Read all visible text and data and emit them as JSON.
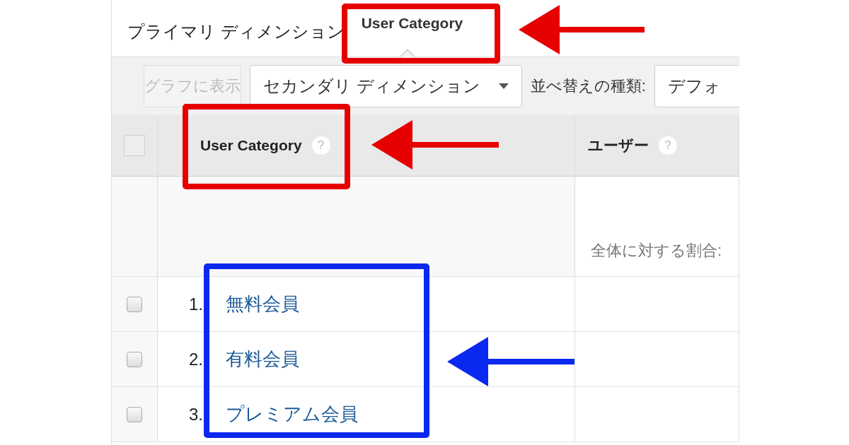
{
  "primary_dimension": {
    "label": "プライマリ ディメンション",
    "tabs": [
      {
        "label": "User Category",
        "selected": true
      }
    ]
  },
  "toolbar": {
    "chart_button": {
      "label": "グラフに表示",
      "disabled": true
    },
    "secondary_dimension": {
      "label": "セカンダリ ディメンション"
    },
    "sort_label": "並べ替えの種類:",
    "sort_select": {
      "value": "デフォ"
    }
  },
  "table": {
    "select_all": {
      "checked": false
    },
    "columns": [
      {
        "label": "User Category",
        "help": "?"
      },
      {
        "label": "ユーザー",
        "help": "?"
      }
    ],
    "summary": {
      "column_2": "全体に対する割合:"
    },
    "rows": [
      {
        "index": "1.",
        "label": "無料会員",
        "checked": false
      },
      {
        "index": "2.",
        "label": "有料会員",
        "checked": false
      },
      {
        "index": "3.",
        "label": "プレミアム会員",
        "checked": false
      }
    ]
  },
  "annotations": [
    {
      "kind": "box",
      "color": "#e60000"
    },
    {
      "kind": "arrow",
      "color": "#e60000"
    },
    {
      "kind": "box",
      "color": "#e60000"
    },
    {
      "kind": "arrow",
      "color": "#e60000"
    },
    {
      "kind": "box",
      "color": "#0a28f0"
    },
    {
      "kind": "arrow",
      "color": "#0a28f0"
    }
  ]
}
